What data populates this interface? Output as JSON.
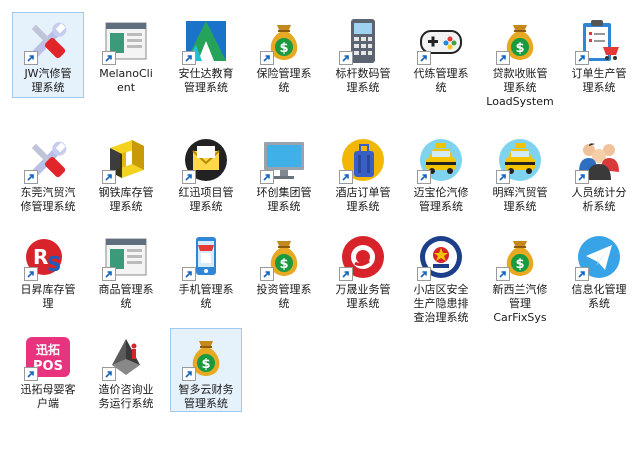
{
  "desktop": {
    "icons": [
      {
        "label": "JW汽修管\n理系统",
        "icon": "wrench-screwdriver-icon"
      },
      {
        "label": "MelanoCli\nent",
        "icon": "window-app-icon"
      },
      {
        "label": "安仕达教育\n管理系统",
        "icon": "green-triangle-logo-icon"
      },
      {
        "label": "保险管理系\n统",
        "icon": "money-bag-icon"
      },
      {
        "label": "标杆数码管\n理系统",
        "icon": "phone-keypad-icon"
      },
      {
        "label": "代练管理系\n统",
        "icon": "gamepad-icon"
      },
      {
        "label": "贷款收账管\n理系统\nLoadSystem",
        "icon": "money-bag-icon"
      },
      {
        "label": "订单生产管\n理系统",
        "icon": "clipboard-cart-icon"
      },
      {
        "label": "东莞汽贸汽\n修管理系统",
        "icon": "wrench-screwdriver-icon"
      },
      {
        "label": "钢铁库存管\n理系统",
        "icon": "steel-beam-icon"
      },
      {
        "label": "红迅项目管\n理系统",
        "icon": "mail-envelope-icon"
      },
      {
        "label": "环创集团管\n理系统",
        "icon": "monitor-icon"
      },
      {
        "label": "酒店订单管\n理系统",
        "icon": "suitcase-icon"
      },
      {
        "label": "迈宝伦汽修\n管理系统",
        "icon": "taxi-icon"
      },
      {
        "label": "明辉汽贸管\n理系统",
        "icon": "taxi-icon"
      },
      {
        "label": "人员统计分\n析系统",
        "icon": "people-group-icon"
      },
      {
        "label": "日昇库存管\n理",
        "icon": "rs-logo-icon"
      },
      {
        "label": "商品管理系\n统",
        "icon": "window-app-icon"
      },
      {
        "label": "手机管理系\n统",
        "icon": "phone-store-icon"
      },
      {
        "label": "投资管理系\n统",
        "icon": "money-bag-icon"
      },
      {
        "label": "万晟业务管\n理系统",
        "icon": "red-camera-icon"
      },
      {
        "label": "小店区安全\n生产隐患排\n查治理系统",
        "icon": "police-badge-icon"
      },
      {
        "label": "新西兰汽修\n管理\nCarFixSys",
        "icon": "money-bag-icon"
      },
      {
        "label": "信息化管理\n系统",
        "icon": "paper-plane-icon"
      },
      {
        "label": "迅拓母婴客\n户端",
        "icon": "pos-logo-icon"
      },
      {
        "label": "造价咨询业\n务运行系统",
        "icon": "cube-logo-icon"
      },
      {
        "label": "智多云财务\n管理系统",
        "icon": "money-bag-icon"
      }
    ]
  }
}
